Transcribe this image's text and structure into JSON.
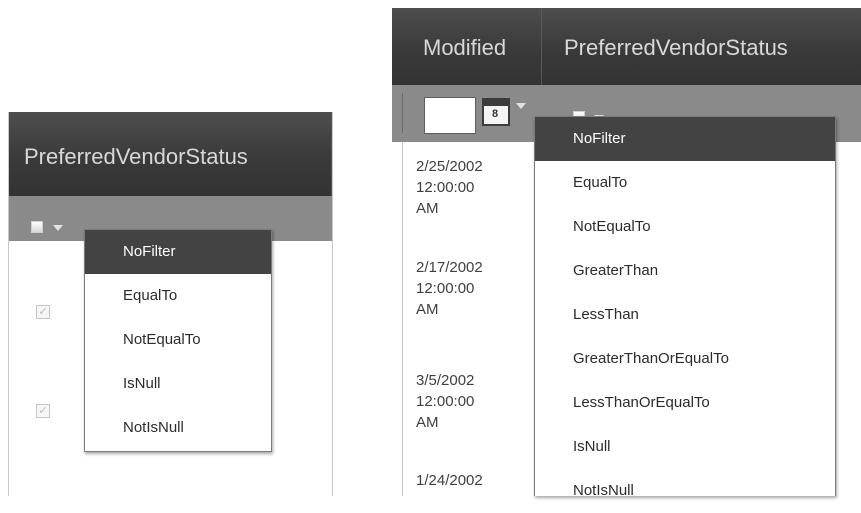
{
  "left_grid": {
    "header": "PreferredVendorStatus",
    "filter_menu": {
      "items": [
        "NoFilter",
        "EqualTo",
        "NotEqualTo",
        "IsNull",
        "NotIsNull"
      ],
      "selected": "NoFilter"
    },
    "rows": [
      {
        "checked": true
      },
      {
        "checked": true
      }
    ]
  },
  "right_grid": {
    "headers": [
      "Modified",
      "PreferredVendorStatus"
    ],
    "filter_menu": {
      "items": [
        "NoFilter",
        "EqualTo",
        "NotEqualTo",
        "GreaterThan",
        "LessThan",
        "GreaterThanOrEqualTo",
        "LessThanOrEqualTo",
        "IsNull",
        "NotIsNull"
      ],
      "selected": "NoFilter"
    },
    "calendar_icon_text": "8",
    "dates": [
      {
        "date": "2/25/2002",
        "time": "12:00:00",
        "ampm": "AM"
      },
      {
        "date": "2/17/2002",
        "time": "12:00:00",
        "ampm": "AM"
      },
      {
        "date": "3/5/2002",
        "time": "12:00:00",
        "ampm": "AM"
      },
      {
        "date": "1/24/2002",
        "time": "",
        "ampm": ""
      }
    ]
  },
  "colors": {
    "header_bg": "#3a3a3a",
    "header_text": "#d4d4d4",
    "filter_row_bg": "#8a8a8a",
    "menu_selected_bg": "#434343"
  }
}
